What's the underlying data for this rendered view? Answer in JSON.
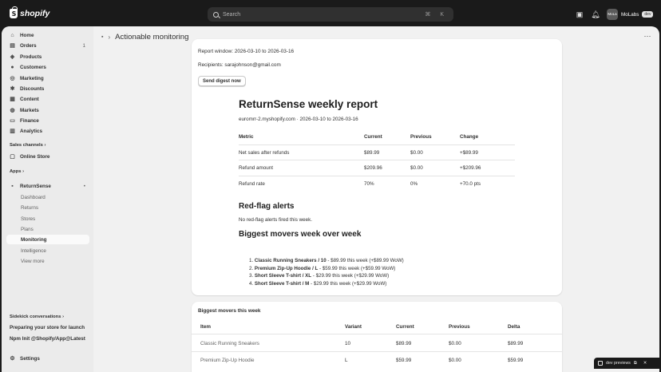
{
  "topbar": {
    "logo_text": "shopify",
    "search_placeholder": "Search",
    "search_shortcut": "⌘ K",
    "store_initials": "MoLa",
    "store_name": "MoLabs",
    "store_badge": "dev"
  },
  "sidebar": {
    "items": [
      {
        "label": "Home",
        "icon": "home-icon"
      },
      {
        "label": "Orders",
        "icon": "orders-icon",
        "count": "1"
      },
      {
        "label": "Products",
        "icon": "products-icon"
      },
      {
        "label": "Customers",
        "icon": "customers-icon"
      },
      {
        "label": "Marketing",
        "icon": "marketing-icon"
      },
      {
        "label": "Discounts",
        "icon": "discounts-icon"
      },
      {
        "label": "Content",
        "icon": "content-icon"
      },
      {
        "label": "Markets",
        "icon": "markets-icon"
      },
      {
        "label": "Finance",
        "icon": "finance-icon"
      },
      {
        "label": "Analytics",
        "icon": "analytics-icon"
      }
    ],
    "sales_channels_label": "Sales channels",
    "online_store_label": "Online Store",
    "apps_label": "Apps",
    "app_name": "ReturnSense",
    "app_subitems": [
      "Dashboard",
      "Returns",
      "Stores",
      "Plans",
      "Monitoring",
      "Intelligence",
      "View more"
    ],
    "active_subitem": "Monitoring",
    "sidekick_label": "Sidekick conversations",
    "conversation_1": "Preparing your store for launch",
    "conversation_2": "Npm Init @Shopify/App@Latest",
    "settings_label": "Settings"
  },
  "page": {
    "title": "Actionable monitoring"
  },
  "digest": {
    "report_window": "Report window: 2026-03-10 to 2026-03-16",
    "recipients": "Recipients: sarajohnson@gmail.com",
    "send_button": "Send digest now"
  },
  "report": {
    "title": "ReturnSense weekly report",
    "subtitle": "euromrr-2.myshopify.com · 2026-03-10 to 2026-03-16",
    "table_headers": [
      "Metric",
      "Current",
      "Previous",
      "Change"
    ],
    "table_rows": [
      [
        "Net sales after refunds",
        "$89.99",
        "$0.00",
        "+$89.99"
      ],
      [
        "Refund amount",
        "$209.96",
        "$0.00",
        "+$209.96"
      ],
      [
        "Refund rate",
        "70%",
        "0%",
        "+70.0 pts"
      ]
    ],
    "alerts_heading": "Red-flag alerts",
    "alerts_text": "No red-flag alerts fired this week.",
    "movers_heading": "Biggest movers week over week",
    "movers": [
      {
        "num": "1.",
        "name": "Classic Running Sneakers / 10",
        "detail": " - $89.99 this week (+$89.99 WoW)"
      },
      {
        "num": "2.",
        "name": "Premium Zip-Up Hoodie / L",
        "detail": " - $59.99 this week (+$59.99 WoW)"
      },
      {
        "num": "3.",
        "name": "Short Sleeve T-shirt / XL",
        "detail": " - $29.99 this week (+$29.99 WoW)"
      },
      {
        "num": "4.",
        "name": "Short Sleeve T-shirt / M",
        "detail": " - $29.99 this week (+$29.99 WoW)"
      }
    ]
  },
  "movers_card": {
    "title": "Biggest movers this week",
    "headers": [
      "Item",
      "Variant",
      "Current",
      "Previous",
      "Delta"
    ],
    "rows": [
      [
        "Classic Running Sneakers",
        "10",
        "$89.99",
        "$0.00",
        "$89.99"
      ],
      [
        "Premium Zip-Up Hoodie",
        "L",
        "$59.99",
        "$0.00",
        "$59.99"
      ]
    ]
  },
  "devbar": {
    "label": "dev previews"
  }
}
